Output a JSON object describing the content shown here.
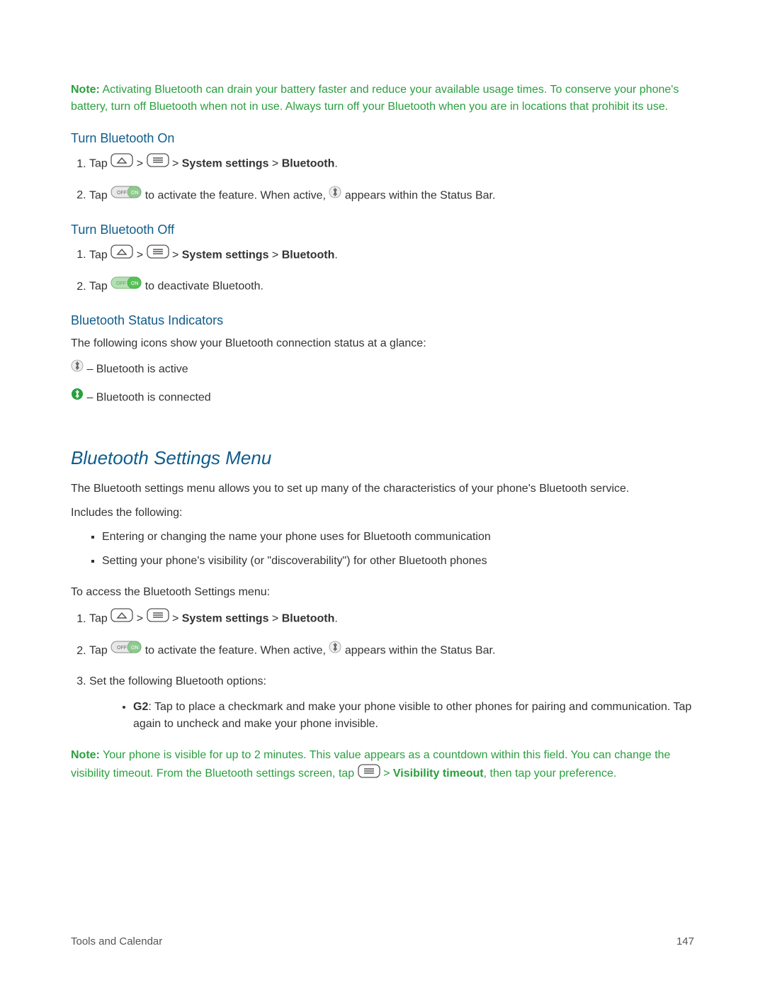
{
  "note1": {
    "label": "Note:",
    "text": "Activating Bluetooth can drain your battery faster and reduce your available usage times. To conserve your phone's battery, turn off Bluetooth when not in use. Always turn off your Bluetooth when you are in locations that prohibit its use."
  },
  "turnOn": {
    "heading": "Turn Bluetooth On",
    "step1_tap": "Tap",
    "step1_sep": ">",
    "step1_sys": "System settings",
    "step1_bt": "Bluetooth",
    "step2_tap": "Tap",
    "step2_mid": "to activate the feature. When active,",
    "step2_end": "appears within the Status Bar."
  },
  "turnOff": {
    "heading": "Turn Bluetooth Off",
    "step1_tap": "Tap",
    "step1_sep": ">",
    "step1_sys": "System settings",
    "step1_bt": "Bluetooth",
    "step2_tap": "Tap",
    "step2_end": "to deactivate Bluetooth."
  },
  "indicators": {
    "heading": "Bluetooth Status Indicators",
    "intro": "The following icons show your Bluetooth connection status at a glance:",
    "active": "– Bluetooth is active",
    "connected": "– Bluetooth is connected"
  },
  "settingsMenu": {
    "title": "Bluetooth Settings Menu",
    "intro": "The Bluetooth settings menu allows you to set up many of the characteristics of your phone's Bluetooth service.",
    "includes": "Includes the following:",
    "bullet1": "Entering or changing the name your phone uses for Bluetooth communication",
    "bullet2": "Setting your phone's visibility (or \"discoverability\") for other Bluetooth phones",
    "access": "To access the Bluetooth Settings menu:",
    "step1_tap": "Tap",
    "step1_sep": ">",
    "step1_sys": "System settings",
    "step1_bt": "Bluetooth",
    "step2_tap": "Tap",
    "step2_mid": "to activate the feature. When active,",
    "step2_end": "appears within the Status Bar.",
    "step3": "Set the following Bluetooth options:",
    "g2_label": "G2",
    "g2_text": ": Tap to place a checkmark and make your phone visible to other phones for pairing and communication. Tap again to uncheck and make your phone invisible."
  },
  "note2": {
    "label": "Note:",
    "text1": "Your phone is visible for up to 2 minutes. This value appears as a countdown within this field. You can change the visibility timeout. From the Bluetooth settings screen, tap",
    "sep": ">",
    "vis": "Visibility timeout",
    "text2": ", then tap your preference."
  },
  "footer": {
    "left": "Tools and Calendar",
    "right": "147"
  }
}
